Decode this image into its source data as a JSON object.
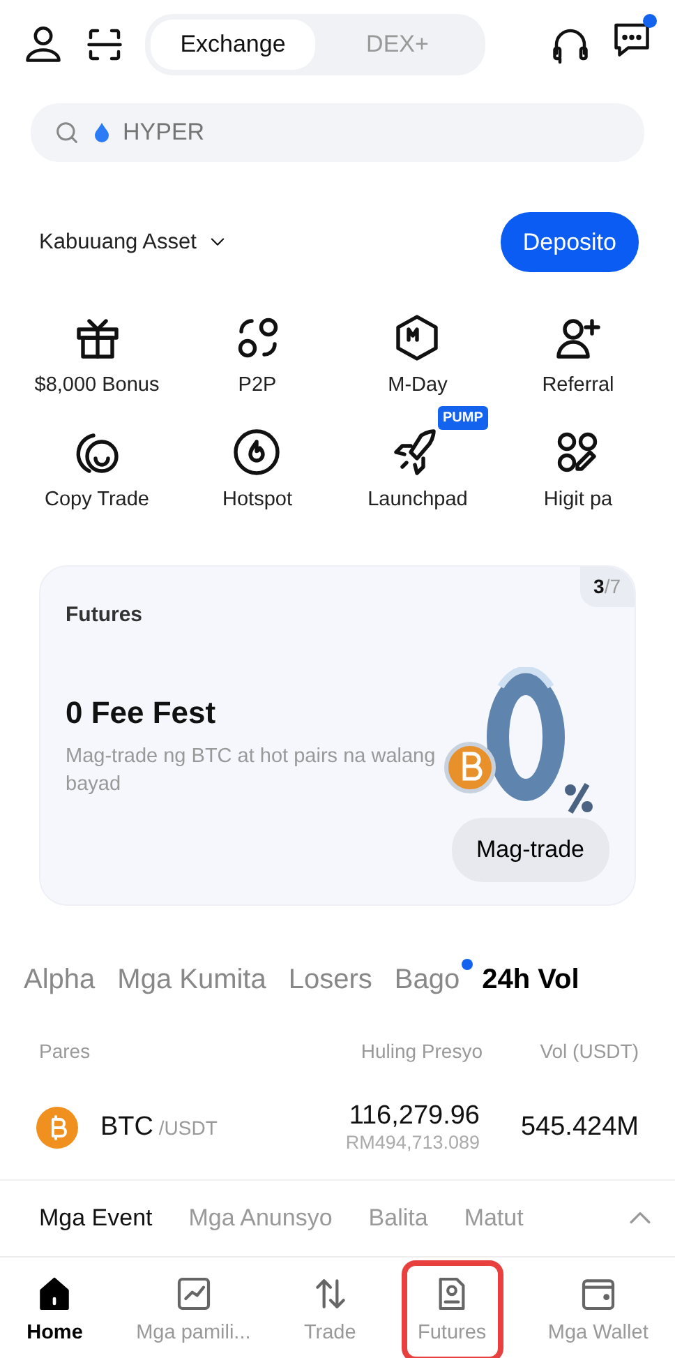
{
  "header": {
    "segments": [
      {
        "label": "Exchange",
        "selected": true
      },
      {
        "label": "DEX+",
        "selected": false
      }
    ],
    "message_unread": true
  },
  "search": {
    "placeholder": "HYPER"
  },
  "asset": {
    "label": "Kabuuang Asset",
    "button": "Deposito"
  },
  "shortcuts": [
    {
      "label": "$8,000 Bonus"
    },
    {
      "label": "P2P"
    },
    {
      "label": "M-Day"
    },
    {
      "label": "Referral"
    },
    {
      "label": "Copy Trade"
    },
    {
      "label": "Hotspot"
    },
    {
      "label": "Launchpad",
      "badge": "PUMP"
    },
    {
      "label": "Higit pa"
    }
  ],
  "banner": {
    "category": "Futures",
    "page": "3",
    "total": "/7",
    "title": "0 Fee Fest",
    "text": "Mag-trade ng BTC at hot pairs na walang bayad",
    "button": "Mag-trade"
  },
  "market_tabs": [
    {
      "label": "Alpha",
      "selected": false,
      "dot": false
    },
    {
      "label": "Mga Kumita",
      "selected": false,
      "dot": false
    },
    {
      "label": "Losers",
      "selected": false,
      "dot": false
    },
    {
      "label": "Bago",
      "selected": false,
      "dot": true
    },
    {
      "label": "24h Vol",
      "selected": true,
      "dot": false
    }
  ],
  "table": {
    "columns": [
      "Pares",
      "Huling Presyo",
      "Vol (USDT)"
    ],
    "rows": [
      {
        "base": "BTC",
        "quote": "/USDT",
        "price": "116,279.96",
        "local_price": "RM494,713.089",
        "volume": "545.424M"
      }
    ]
  },
  "news_tabs": [
    {
      "label": "Mga Event",
      "selected": true
    },
    {
      "label": "Mga Anunsyo",
      "selected": false
    },
    {
      "label": "Balita",
      "selected": false
    },
    {
      "label": "Matut",
      "selected": false
    }
  ],
  "bottom_nav": [
    {
      "label": "Home",
      "selected": true,
      "highlighted": false
    },
    {
      "label": "Mga pamili...",
      "selected": false,
      "highlighted": false
    },
    {
      "label": "Trade",
      "selected": false,
      "highlighted": false
    },
    {
      "label": "Futures",
      "selected": false,
      "highlighted": true
    },
    {
      "label": "Mga Wallet",
      "selected": false,
      "highlighted": false
    }
  ]
}
